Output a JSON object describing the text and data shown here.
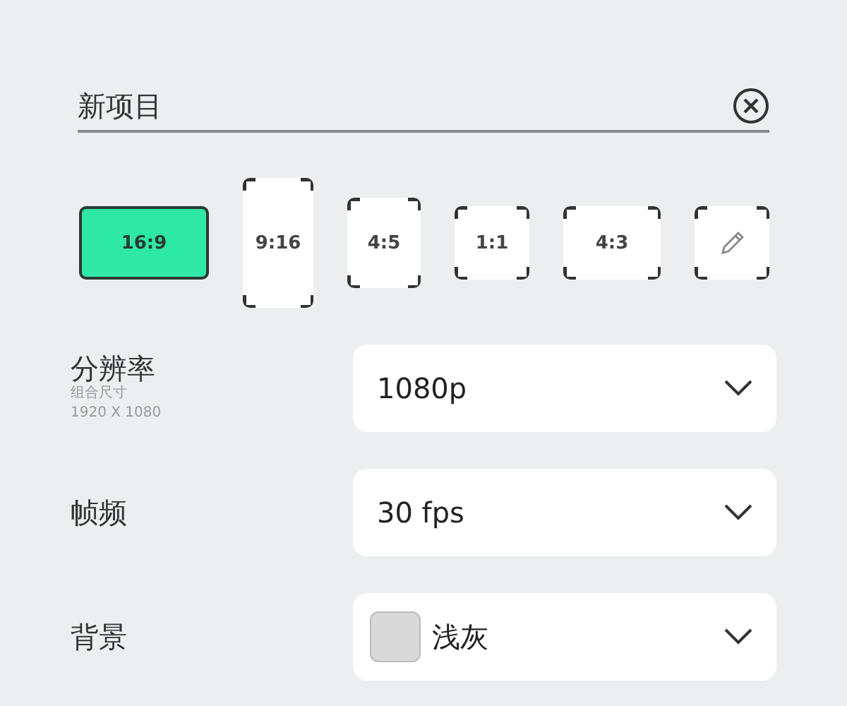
{
  "project_name": {
    "value": "新项目"
  },
  "aspect_ratios": [
    {
      "kind": "ratio",
      "label": "16:9",
      "selected": true
    },
    {
      "kind": "ratio",
      "label": "9:16",
      "selected": false
    },
    {
      "kind": "ratio",
      "label": "4:5",
      "selected": false
    },
    {
      "kind": "ratio",
      "label": "1:1",
      "selected": false
    },
    {
      "kind": "ratio",
      "label": "4:3",
      "selected": false
    },
    {
      "kind": "custom",
      "selected": false
    }
  ],
  "settings": [
    {
      "kind": "plain",
      "label": "分辨率",
      "hints": [
        "组合尺寸",
        "1920 X 1080"
      ],
      "value": "1080p"
    },
    {
      "kind": "plain",
      "label": "帧频",
      "value": "30 fps"
    },
    {
      "kind": "swatch",
      "label": "背景",
      "value": "浅灰",
      "color": "#d9d9d9"
    }
  ]
}
